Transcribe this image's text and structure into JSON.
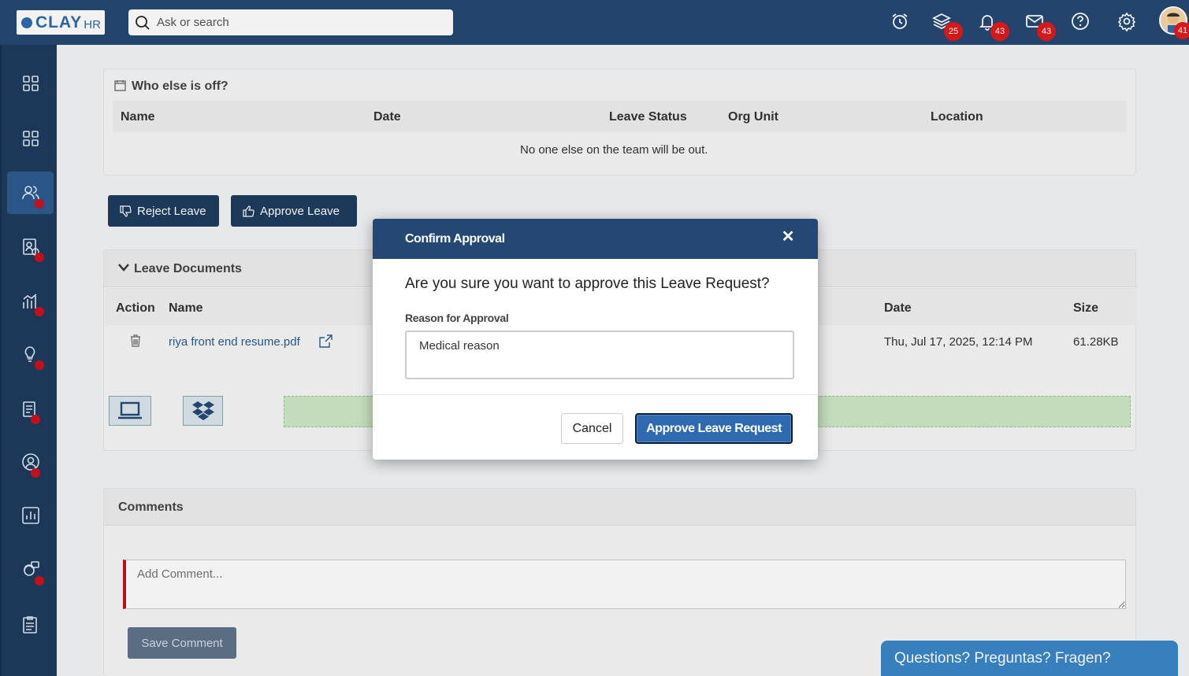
{
  "topbar": {
    "logo_text": "CLAY",
    "logo_suffix": "HR",
    "search_placeholder": "Ask or search",
    "icons": [
      {
        "name": "alarm-clock-icon"
      },
      {
        "name": "layers-icon",
        "badge": "25"
      },
      {
        "name": "bell-icon",
        "badge": "43"
      },
      {
        "name": "mail-icon",
        "badge": "43"
      },
      {
        "name": "help-icon"
      },
      {
        "name": "settings-gear-icon"
      }
    ],
    "avatar_badge": "41"
  },
  "sidebar": {
    "items": [
      {
        "name": "dashboard-grid-icon"
      },
      {
        "name": "apps-grid-icon"
      },
      {
        "name": "people-icon",
        "active": true
      },
      {
        "name": "clipboard-user-icon"
      },
      {
        "name": "analytics-icon"
      },
      {
        "name": "ideas-bulb-icon"
      },
      {
        "name": "documents-icon"
      },
      {
        "name": "profile-circle-icon"
      },
      {
        "name": "reports-chart-icon"
      },
      {
        "name": "support-agent-icon"
      },
      {
        "name": "checklist-icon"
      }
    ]
  },
  "who_off": {
    "title": "Who else is off?",
    "headers": [
      "Name",
      "Date",
      "Leave Status",
      "Org Unit",
      "Location"
    ],
    "empty_message": "No one else on the team will be out."
  },
  "actions": {
    "reject": "Reject Leave",
    "approve": "Approve Leave"
  },
  "documents": {
    "title": "Leave Documents",
    "headers": {
      "action": "Action",
      "name": "Name",
      "date": "Date",
      "size": "Size"
    },
    "rows": [
      {
        "name": "riya front end resume.pdf",
        "date": "Thu, Jul 17, 2025, 12:14 PM",
        "size": "61.28KB"
      }
    ]
  },
  "comments": {
    "title": "Comments",
    "placeholder": "Add Comment...",
    "save": "Save Comment"
  },
  "modal": {
    "title": "Confirm Approval",
    "question": "Are you sure you want to approve this Leave Request?",
    "reason_label": "Reason for Approval",
    "reason_value": "Medical reason",
    "cancel": "Cancel",
    "confirm": "Approve Leave Request"
  },
  "chat": {
    "label": "Questions? Preguntas? Fragen?"
  },
  "colors": {
    "navy": "#244873",
    "sidebar": "#1e3c5e",
    "primary": "#2f6ab0",
    "badge": "#e21a1a"
  }
}
